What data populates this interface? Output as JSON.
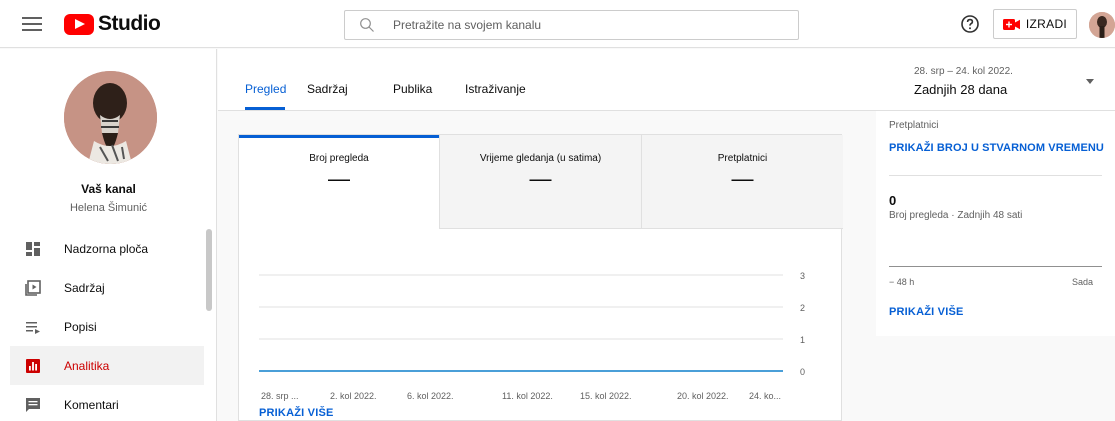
{
  "header": {
    "logo_text": "Studio",
    "search_placeholder": "Pretražite na svojem kanalu",
    "create_label": "IZRADI"
  },
  "sidebar": {
    "channel_title": "Vaš kanal",
    "channel_name": "Helena Šimunić",
    "items": [
      {
        "label": "Nadzorna ploča",
        "icon": "dashboard-icon"
      },
      {
        "label": "Sadržaj",
        "icon": "content-icon"
      },
      {
        "label": "Popisi",
        "icon": "playlists-icon"
      },
      {
        "label": "Analitika",
        "icon": "analytics-icon",
        "active": true
      },
      {
        "label": "Komentari",
        "icon": "comments-icon"
      }
    ]
  },
  "tabs": [
    {
      "label": "Pregled",
      "active": true
    },
    {
      "label": "Sadržaj"
    },
    {
      "label": "Publika"
    },
    {
      "label": "Istraživanje"
    }
  ],
  "date_range": {
    "range": "28. srp – 24. kol 2022.",
    "label": "Zadnjih 28 dana"
  },
  "metrics": [
    {
      "label": "Broj pregleda",
      "value": "—"
    },
    {
      "label": "Vrijeme gledanja (u satima)",
      "value": "—"
    },
    {
      "label": "Pretplatnici",
      "value": "—"
    }
  ],
  "chart_data": {
    "type": "line",
    "x": [
      "28. srp ...",
      "2. kol 2022.",
      "6. kol 2022.",
      "11. kol 2022.",
      "15. kol 2022.",
      "20. kol 2022.",
      "24. ko..."
    ],
    "series": [
      {
        "values": [
          0,
          0,
          0,
          0,
          0,
          0,
          0
        ]
      }
    ],
    "yticks": [
      "3",
      "2",
      "1",
      "0"
    ],
    "ylim": [
      0,
      3
    ],
    "grid": true,
    "line_color": "#4a9fd8"
  },
  "main": {
    "see_more": "PRIKAŽI VIŠE"
  },
  "realtime": {
    "subtitle": "Pretplatnici",
    "link": "PRIKAŽI BROJ U STVARNOM VREMENU",
    "count": "0",
    "desc": "Broj pregleda · Zadnjih 48 sati",
    "axis_left": "− 48 h",
    "axis_right": "Sada",
    "see_more": "PRIKAŽI VIŠE"
  },
  "colors": {
    "accent": "#065fd4",
    "brand": "#ff0000",
    "active_nav": "#cc0000"
  }
}
